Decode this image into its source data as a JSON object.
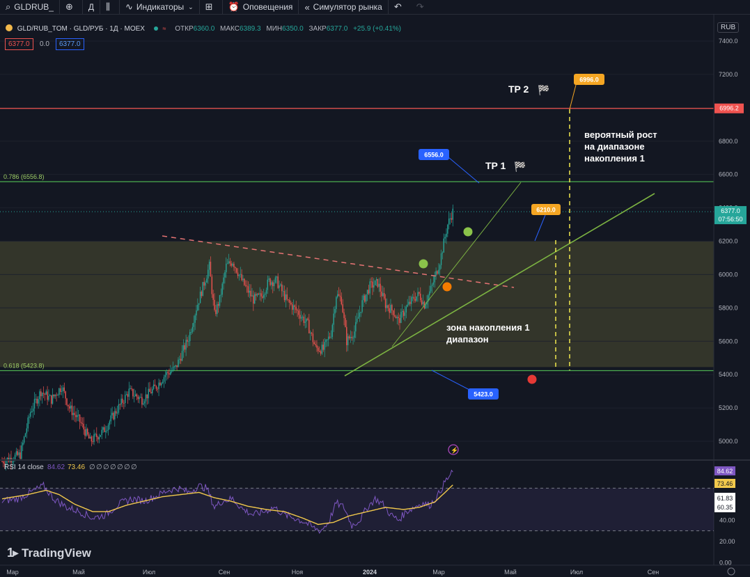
{
  "toolbar": {
    "symbol": "GLDRUB_",
    "add_icon": "plus-circle-icon",
    "interval": "Д",
    "chart_type_icon": "candles-icon",
    "indicators_label": "Индикаторы",
    "layout_icon": "layout-grid-icon",
    "alerts_label": "Оповещения",
    "replay_label": "Симулятор рынка",
    "undo_icon": "undo-icon",
    "redo_icon": "redo-icon"
  },
  "legend": {
    "title": "GLD/RUB_TOM · GLD/РУБ · 1Д · MOEX",
    "open_label": "ОТКР",
    "open": "6360.0",
    "high_label": "МАКС",
    "high": "6389.3",
    "low_label": "МИН",
    "low": "6350.0",
    "close_label": "ЗАКР",
    "close": "6377.0",
    "change": "+25.9 (+0.41%)",
    "bid": "6377.0",
    "spread": "0.0",
    "ask": "6377.0"
  },
  "currency": "RUB",
  "colors": {
    "up": "#26a69a",
    "down": "#ef5350",
    "bg": "#131722",
    "accent": "#2962ff",
    "zone": "#3a3b2c",
    "fib_786": "#4caf50",
    "fib_618": "#4caf50",
    "rsi": "#7e57c2",
    "rsi_ma": "#f2c94c"
  },
  "chart_data": [
    {
      "type": "candlestick",
      "title": "GLD/RUB_TOM · GLD/РУБ · 1Д · MOEX",
      "x_ticks": [
        "Мар",
        "Май",
        "Июл",
        "Сен",
        "Ноя",
        "2024",
        "Мар",
        "Май",
        "Июл",
        "Сен"
      ],
      "ylim": [
        4900,
        7450
      ],
      "y_ticks": [
        5000,
        5200,
        5400,
        5600,
        5800,
        6000,
        6200,
        6400,
        6600,
        6800,
        7000,
        7200,
        7400
      ],
      "y_tick_labels": [
        "5000.0",
        "5200.0",
        "5400.0",
        "5600.0",
        "5800.0",
        "6000.0",
        "6200.0",
        "6400.0",
        "6600.0",
        "6800.0",
        "7000.0",
        "7200.0",
        "7400.0"
      ],
      "anchors": [
        [
          0,
          4880
        ],
        [
          14,
          4920
        ],
        [
          22,
          5180
        ],
        [
          30,
          5300
        ],
        [
          38,
          5250
        ],
        [
          46,
          5330
        ],
        [
          52,
          5200
        ],
        [
          60,
          5120
        ],
        [
          68,
          5000
        ],
        [
          78,
          5060
        ],
        [
          88,
          5180
        ],
        [
          98,
          5300
        ],
        [
          108,
          5250
        ],
        [
          118,
          5320
        ],
        [
          126,
          5400
        ],
        [
          134,
          5440
        ],
        [
          144,
          5620
        ],
        [
          150,
          5800
        ],
        [
          156,
          5950
        ],
        [
          160,
          6050
        ],
        [
          164,
          5760
        ],
        [
          168,
          5850
        ],
        [
          173,
          6050
        ],
        [
          178,
          6080
        ],
        [
          186,
          5950
        ],
        [
          194,
          5850
        ],
        [
          200,
          5870
        ],
        [
          206,
          5960
        ],
        [
          212,
          5960
        ],
        [
          220,
          5840
        ],
        [
          228,
          5780
        ],
        [
          236,
          5700
        ],
        [
          242,
          5560
        ],
        [
          248,
          5550
        ],
        [
          254,
          5650
        ],
        [
          258,
          5880
        ],
        [
          262,
          5850
        ],
        [
          266,
          5600
        ],
        [
          272,
          5660
        ],
        [
          278,
          5830
        ],
        [
          284,
          5930
        ],
        [
          290,
          5950
        ],
        [
          296,
          5820
        ],
        [
          302,
          5780
        ],
        [
          306,
          5720
        ],
        [
          312,
          5800
        ],
        [
          318,
          5860
        ],
        [
          322,
          5880
        ],
        [
          326,
          5820
        ],
        [
          332,
          5930
        ],
        [
          338,
          6080
        ],
        [
          344,
          6300
        ],
        [
          348,
          6377
        ]
      ],
      "last_price": "6377.0",
      "countdown": "07:56:50",
      "fib_786": {
        "label": "0.786 (6556.8)",
        "value": 6556.8
      },
      "fib_618": {
        "label": "0.618 (5423.8)",
        "value": 5423.8
      },
      "resistance": {
        "value": 6996.2,
        "label": "6996.2"
      },
      "zone": {
        "low": 5445,
        "high": 6200,
        "label_line1": "зона накопления 1",
        "label_line2": "диапазон"
      },
      "annotations": [
        {
          "text": "TP 2",
          "value": 6996.0,
          "box": "6996.0"
        },
        {
          "text": "TP 1",
          "value": 6556.0,
          "box": "6556.0"
        },
        {
          "value": 6210.0,
          "box": "6210.0"
        },
        {
          "value": 5423.0,
          "box": "5423.0"
        }
      ],
      "forecast_text": [
        "вероятный рост",
        "на диапазоне",
        "накопления 1"
      ]
    },
    {
      "type": "line",
      "title": "RSI 14 close",
      "rsi_value": "84.62",
      "ma_value": "73.46",
      "extra_values": [
        "∅",
        "∅",
        "∅",
        "∅",
        "∅",
        "∅",
        "∅"
      ],
      "ylim": [
        0,
        100
      ],
      "y_ticks": [
        0,
        20,
        40,
        61.83,
        60.35,
        73.46,
        84.62
      ],
      "y_tick_labels": [
        "0.00",
        "20.00",
        "40.00",
        "61.83",
        "60.35",
        "73.46",
        "84.62"
      ],
      "bands": [
        30,
        70
      ],
      "rsi_anchors": [
        [
          0,
          58
        ],
        [
          12,
          60
        ],
        [
          22,
          66
        ],
        [
          32,
          72
        ],
        [
          40,
          60
        ],
        [
          50,
          52
        ],
        [
          60,
          48
        ],
        [
          70,
          42
        ],
        [
          80,
          45
        ],
        [
          90,
          55
        ],
        [
          100,
          60
        ],
        [
          110,
          58
        ],
        [
          120,
          63
        ],
        [
          128,
          68
        ],
        [
          136,
          70
        ],
        [
          144,
          66
        ],
        [
          152,
          72
        ],
        [
          158,
          70
        ],
        [
          164,
          52
        ],
        [
          170,
          58
        ],
        [
          178,
          60
        ],
        [
          186,
          50
        ],
        [
          194,
          45
        ],
        [
          202,
          48
        ],
        [
          210,
          52
        ],
        [
          218,
          45
        ],
        [
          226,
          42
        ],
        [
          234,
          38
        ],
        [
          240,
          33
        ],
        [
          246,
          30
        ],
        [
          252,
          38
        ],
        [
          258,
          56
        ],
        [
          264,
          52
        ],
        [
          270,
          35
        ],
        [
          276,
          40
        ],
        [
          282,
          52
        ],
        [
          288,
          60
        ],
        [
          294,
          55
        ],
        [
          300,
          45
        ],
        [
          306,
          40
        ],
        [
          312,
          48
        ],
        [
          318,
          52
        ],
        [
          324,
          56
        ],
        [
          330,
          54
        ],
        [
          336,
          62
        ],
        [
          342,
          76
        ],
        [
          348,
          85
        ]
      ],
      "ma_anchors": [
        [
          0,
          60
        ],
        [
          20,
          64
        ],
        [
          34,
          68
        ],
        [
          44,
          64
        ],
        [
          56,
          55
        ],
        [
          70,
          48
        ],
        [
          82,
          48
        ],
        [
          96,
          54
        ],
        [
          110,
          58
        ],
        [
          124,
          62
        ],
        [
          138,
          64
        ],
        [
          152,
          66
        ],
        [
          164,
          61
        ],
        [
          176,
          58
        ],
        [
          190,
          53
        ],
        [
          204,
          50
        ],
        [
          218,
          48
        ],
        [
          232,
          42
        ],
        [
          244,
          36
        ],
        [
          256,
          38
        ],
        [
          268,
          44
        ],
        [
          282,
          48
        ],
        [
          296,
          52
        ],
        [
          310,
          50
        ],
        [
          322,
          52
        ],
        [
          334,
          57
        ],
        [
          342,
          66
        ],
        [
          348,
          73
        ]
      ]
    }
  ],
  "branding": {
    "logo_text": "TradingView",
    "logo_icon": "tradingview-logo-icon"
  }
}
